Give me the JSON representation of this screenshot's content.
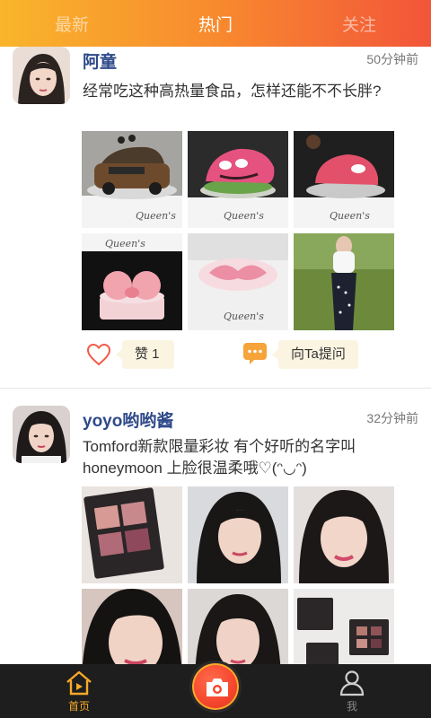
{
  "tabs": [
    {
      "label": "最新",
      "active": false
    },
    {
      "label": "热门",
      "active": true
    },
    {
      "label": "关注",
      "active": false
    }
  ],
  "posts": [
    {
      "username": "阿童",
      "time": "50分钟前",
      "text": "经常吃这种高热量食品，怎样还能不不长胖?",
      "like_label": "赞 1",
      "ask_label": "向Ta提问"
    },
    {
      "username": "yoyo哟哟酱",
      "time": "32分钟前",
      "text": "Tomford新款限量彩妆 有个好听的名字叫honeymoon 上脸很温柔哦♡(ᵔ◡ᵔ)"
    }
  ],
  "bottom_nav": {
    "home_label": "首页",
    "me_label": "我",
    "home_icon": "home-icon",
    "camera_icon": "camera-icon",
    "me_icon": "user-icon"
  },
  "colors": {
    "accent_start": "#f9b52c",
    "accent_end": "#f2553a",
    "username": "#2f4a8a",
    "bubble": "#fbf4e1"
  }
}
